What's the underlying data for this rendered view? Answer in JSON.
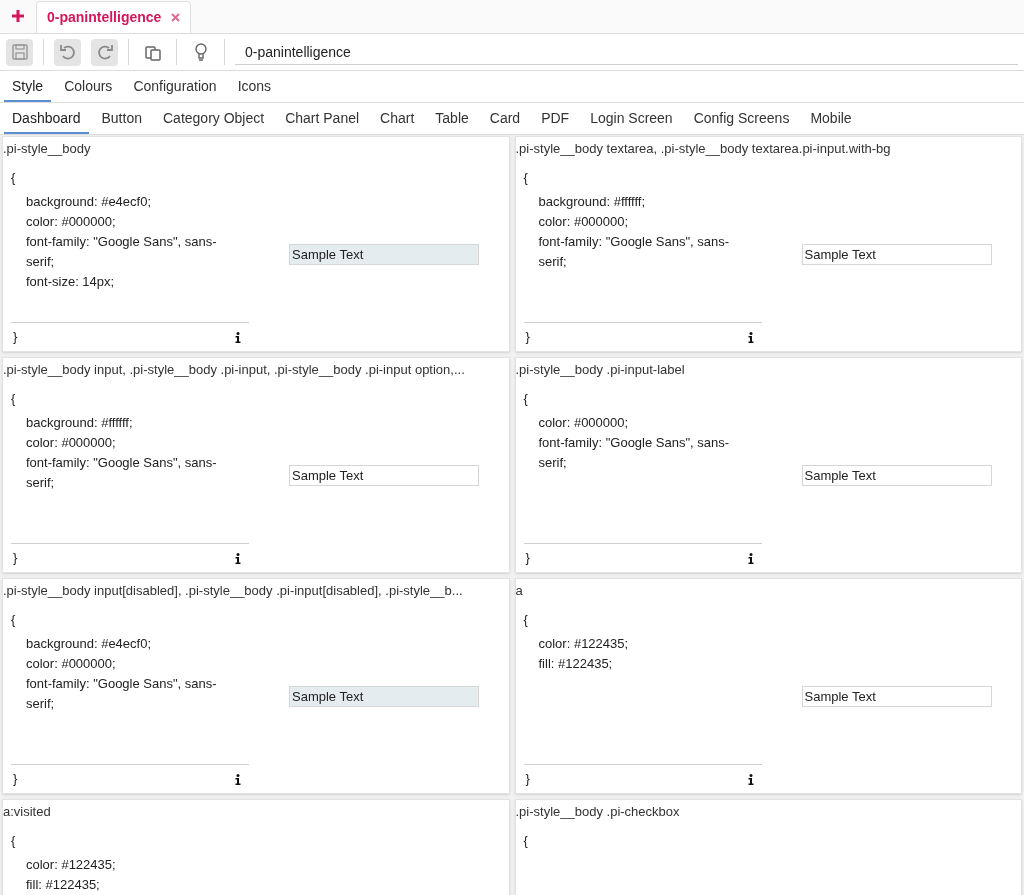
{
  "doc_tabs": [
    {
      "label": "0-panintelligence",
      "selected": true,
      "closable": true
    }
  ],
  "toolbar": {
    "buttons": [
      {
        "kind": "save",
        "disabled": true
      },
      {
        "kind": "undo",
        "disabled": true
      },
      {
        "kind": "redo",
        "disabled": true
      },
      {
        "kind": "copy",
        "disabled": false
      },
      {
        "kind": "bulb",
        "disabled": false
      }
    ],
    "name_field": {
      "value": "0-panintelligence"
    }
  },
  "main_tabs": [
    {
      "label": "Style",
      "selected": true
    },
    {
      "label": "Colours",
      "selected": false
    },
    {
      "label": "Configuration",
      "selected": false
    },
    {
      "label": "Icons",
      "selected": false
    }
  ],
  "sub_tabs": [
    {
      "label": "Dashboard",
      "selected": true
    },
    {
      "label": "Button",
      "selected": false
    },
    {
      "label": "Category Object",
      "selected": false
    },
    {
      "label": "Chart Panel",
      "selected": false
    },
    {
      "label": "Chart",
      "selected": false
    },
    {
      "label": "Table",
      "selected": false
    },
    {
      "label": "Card",
      "selected": false
    },
    {
      "label": "PDF",
      "selected": false
    },
    {
      "label": "Login Screen",
      "selected": false
    },
    {
      "label": "Config Screens",
      "selected": false
    },
    {
      "label": "Mobile",
      "selected": false
    }
  ],
  "cards": [
    {
      "selector": ".pi-style__body",
      "open": "{",
      "lines": [
        "background: #e4ecf0;",
        "color: #000000;",
        "font-family: \"Google Sans\", sans-serif;",
        "font-size: 14px;"
      ],
      "close": "}",
      "sample": {
        "value": "Sample Text",
        "shaded": true
      }
    },
    {
      "selector": ".pi-style__body textarea, .pi-style__body textarea.pi-input.with-bg",
      "open": "{",
      "lines": [
        "background: #ffffff;",
        "color: #000000;",
        "font-family: \"Google Sans\", sans-serif;"
      ],
      "close": "}",
      "sample": {
        "value": "Sample Text",
        "shaded": false
      }
    },
    {
      "selector": ".pi-style__body input, .pi-style__body .pi-input, .pi-style__body .pi-input option,...",
      "open": "{",
      "lines": [
        "background: #ffffff;",
        "color: #000000;",
        "font-family: \"Google Sans\", sans-serif;"
      ],
      "close": "}",
      "sample": {
        "value": "Sample Text",
        "shaded": false
      }
    },
    {
      "selector": ".pi-style__body .pi-input-label",
      "open": "{",
      "lines": [
        "color: #000000;",
        "font-family: \"Google Sans\", sans-serif;"
      ],
      "close": "}",
      "sample": {
        "value": "Sample Text",
        "shaded": false
      }
    },
    {
      "selector": ".pi-style__body input[disabled], .pi-style__body .pi-input[disabled], .pi-style__b...",
      "open": "{",
      "lines": [
        "background: #e4ecf0;",
        "color: #000000;",
        "font-family: \"Google Sans\", sans-serif;"
      ],
      "close": "}",
      "sample": {
        "value": "Sample Text",
        "shaded": true
      }
    },
    {
      "selector": "a",
      "open": "{",
      "lines": [
        "color: #122435;",
        "fill: #122435;"
      ],
      "close": "}",
      "sample": {
        "value": "Sample Text",
        "shaded": false
      }
    },
    {
      "selector": "a:visited",
      "open": "{",
      "lines": [
        "color: #122435;",
        "fill: #122435;"
      ]
    },
    {
      "selector": ".pi-style__body .pi-checkbox",
      "open": "{"
    }
  ]
}
